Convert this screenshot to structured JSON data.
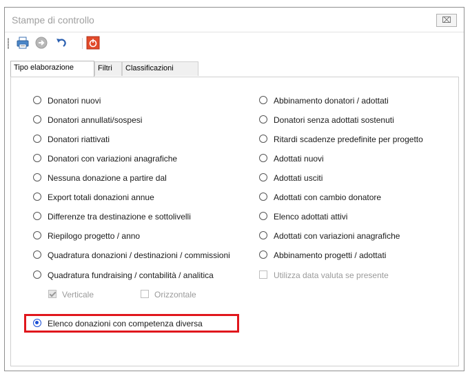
{
  "window": {
    "title": "Stampe di controllo",
    "close_label": "⌧"
  },
  "toolbar": {
    "icons": [
      "printer-icon",
      "forward-icon",
      "undo-icon",
      "power-icon"
    ]
  },
  "tabs": [
    {
      "label": "Tipo elaborazione",
      "active": true
    },
    {
      "label": "Filtri",
      "active": false
    },
    {
      "label": "Classificazioni",
      "active": false
    }
  ],
  "left_options": [
    "Donatori nuovi",
    "Donatori annullati/sospesi",
    "Donatori riattivati",
    "Donatori con variazioni anagrafiche",
    "Nessuna donazione a partire dal",
    "Export totali donazioni annue",
    "Differenze tra destinazione e sottolivelli",
    "Riepilogo progetto / anno",
    "Quadratura donazioni / destinazioni / commissioni",
    "Quadratura fundraising / contabilità / analitica"
  ],
  "right_options": [
    "Abbinamento donatori / adottati",
    "Donatori senza adottati sostenuti",
    "Ritardi scadenze predefinite per progetto",
    "Adottati nuovi",
    "Adottati usciti",
    "Adottati con cambio donatore",
    "Elenco adottati attivi",
    "Adottati con variazioni anagrafiche",
    "Abbinamento progetti / adottati"
  ],
  "checkboxes": {
    "use_date": {
      "label": "Utilizza data valuta se presente",
      "checked": false
    },
    "verticale": {
      "label": "Verticale",
      "checked": true
    },
    "orizzontale": {
      "label": "Orizzontale",
      "checked": false
    }
  },
  "selected_option": "Elenco donazioni con competenza diversa",
  "colors": {
    "selection": "#1a4fd6",
    "highlight": "#e0161c"
  }
}
